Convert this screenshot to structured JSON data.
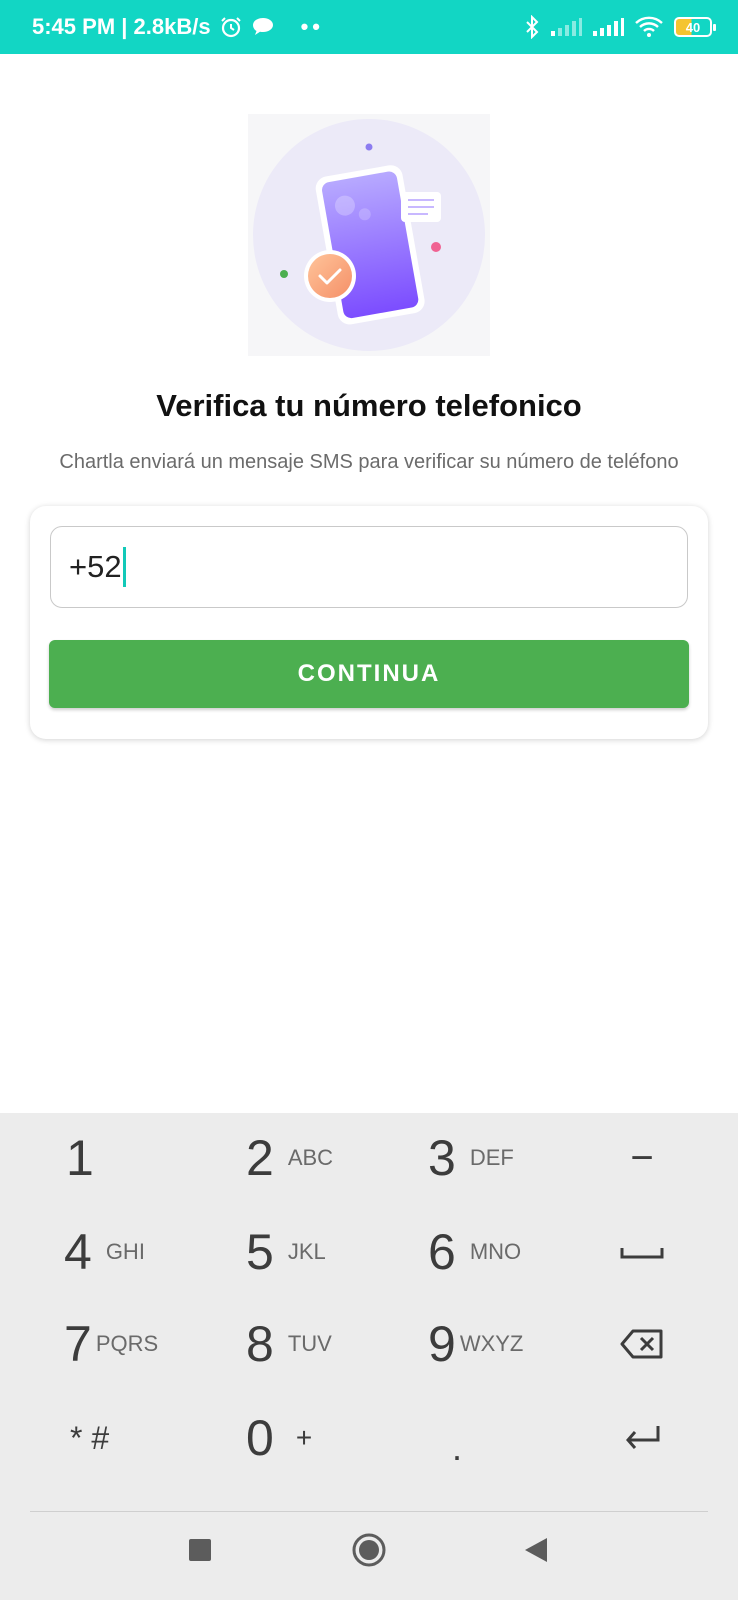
{
  "status_bar": {
    "time_speed": "5:45 PM | 2.8kB/s",
    "dots": "••",
    "battery_level": "40",
    "bg_color": "#12d6c4"
  },
  "page": {
    "title": "Verifica tu número telefonico",
    "subtitle": "Chartla enviará un mensaje SMS para verificar su número de teléfono"
  },
  "form": {
    "phone_value": "+52",
    "continue_label": "CONTINUA",
    "button_color": "#4caf50"
  },
  "keyboard": {
    "keys": [
      {
        "digit": "1",
        "letters": ""
      },
      {
        "digit": "2",
        "letters": "ABC"
      },
      {
        "digit": "3",
        "letters": "DEF"
      },
      {
        "digit": "4",
        "letters": "GHI"
      },
      {
        "digit": "5",
        "letters": "JKL"
      },
      {
        "digit": "6",
        "letters": "MNO"
      },
      {
        "digit": "7",
        "letters": "PQRS"
      },
      {
        "digit": "8",
        "letters": "TUV"
      },
      {
        "digit": "9",
        "letters": "WXYZ"
      },
      {
        "digit": "* #",
        "letters": ""
      },
      {
        "digit": "0",
        "letters": "+"
      },
      {
        "digit": ".",
        "letters": ""
      }
    ],
    "special_keys": {
      "minus": "−",
      "space": "space-icon",
      "backspace": "backspace-icon",
      "enter": "enter-icon"
    }
  },
  "nav": {
    "recent": "square-icon",
    "home": "circle-icon",
    "back": "triangle-back-icon"
  }
}
